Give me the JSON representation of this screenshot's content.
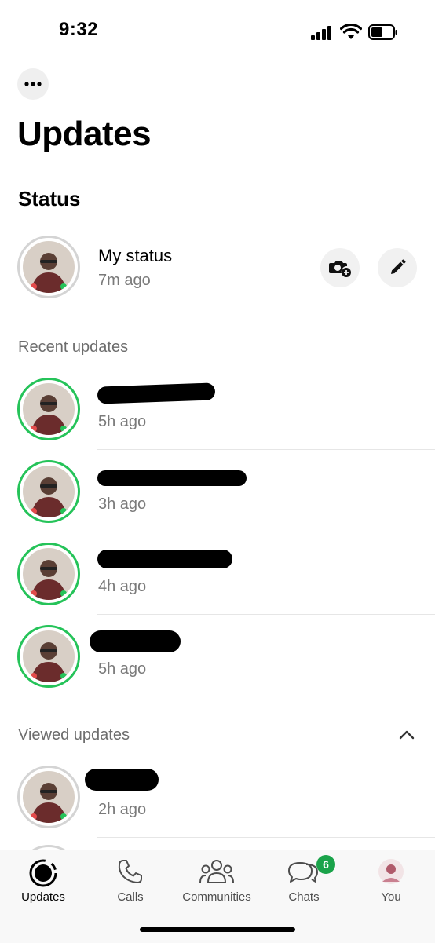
{
  "status_bar": {
    "time": "9:32"
  },
  "header": {
    "title": "Updates"
  },
  "status_section": {
    "title": "Status",
    "my_status": {
      "name": "My status",
      "time": "7m ago"
    }
  },
  "recent": {
    "label": "Recent updates",
    "items": [
      {
        "time": "5h ago"
      },
      {
        "time": "3h ago"
      },
      {
        "time": "4h ago"
      },
      {
        "time": "5h ago"
      }
    ]
  },
  "viewed": {
    "label": "Viewed updates",
    "items": [
      {
        "time": "2h ago"
      }
    ]
  },
  "tabs": [
    {
      "label": "Updates",
      "icon": "updates-icon"
    },
    {
      "label": "Calls",
      "icon": "phone-icon"
    },
    {
      "label": "Communities",
      "icon": "communities-icon"
    },
    {
      "label": "Chats",
      "icon": "chats-icon",
      "badge": "6"
    },
    {
      "label": "You",
      "icon": "profile-avatar"
    }
  ],
  "colors": {
    "ring_unviewed": "#25c359",
    "ring_viewed": "#d4d4d4",
    "badge": "#1aa34a"
  }
}
